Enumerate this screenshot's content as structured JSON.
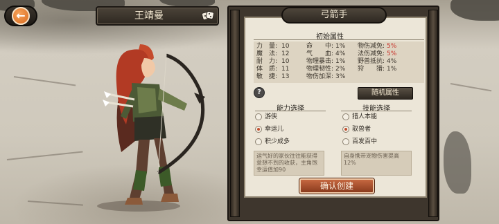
{
  "header": {
    "character_name": "王靖曼",
    "back_icon": "back-arrow-icon",
    "dice_icon": "dice-icon"
  },
  "panel": {
    "class_title": "弓箭手",
    "initial_attrs_title": "初始属性",
    "stats": [
      {
        "label": "力　量:",
        "value": "10"
      },
      {
        "label": "魔　法:",
        "value": "12"
      },
      {
        "label": "耐　力:",
        "value": "10"
      },
      {
        "label": "体　质:",
        "value": "11"
      },
      {
        "label": "敏　捷:",
        "value": "13"
      },
      {
        "label": "命　　中:",
        "value": "1%"
      },
      {
        "label": "气　　血:",
        "value": "4%"
      },
      {
        "label": "物理暴击:",
        "value": "1%"
      },
      {
        "label": "物理韧性:",
        "value": "2%"
      },
      {
        "label": "物伤加深:",
        "value": "3%"
      },
      {
        "label": "物伤减免:",
        "value": "5%"
      },
      {
        "label": "法伤减免:",
        "value": "5%"
      },
      {
        "label": "野兽抵抗:",
        "value": "4%"
      },
      {
        "label": "狩　　猎:",
        "value": "1%"
      }
    ],
    "highlight_color": "#c8322a",
    "help_label": "?",
    "random_attrs_label": "随机属性",
    "ability_title": "能力选择",
    "skill_title": "技能选择",
    "abilities": [
      {
        "label": "游侠",
        "selected": false
      },
      {
        "label": "幸运儿",
        "selected": true
      },
      {
        "label": "积少成多",
        "selected": false
      }
    ],
    "skills": [
      {
        "label": "猎人本能",
        "selected": false
      },
      {
        "label": "驭兽者",
        "selected": true
      },
      {
        "label": "百发百中",
        "selected": false
      }
    ],
    "ability_desc": "运气好的家伙往往能获得意想不到的收获，主角饱幸运值加90",
    "skill_desc": "自身携带宠物伤害提高12%",
    "confirm_label": "确认创建"
  }
}
